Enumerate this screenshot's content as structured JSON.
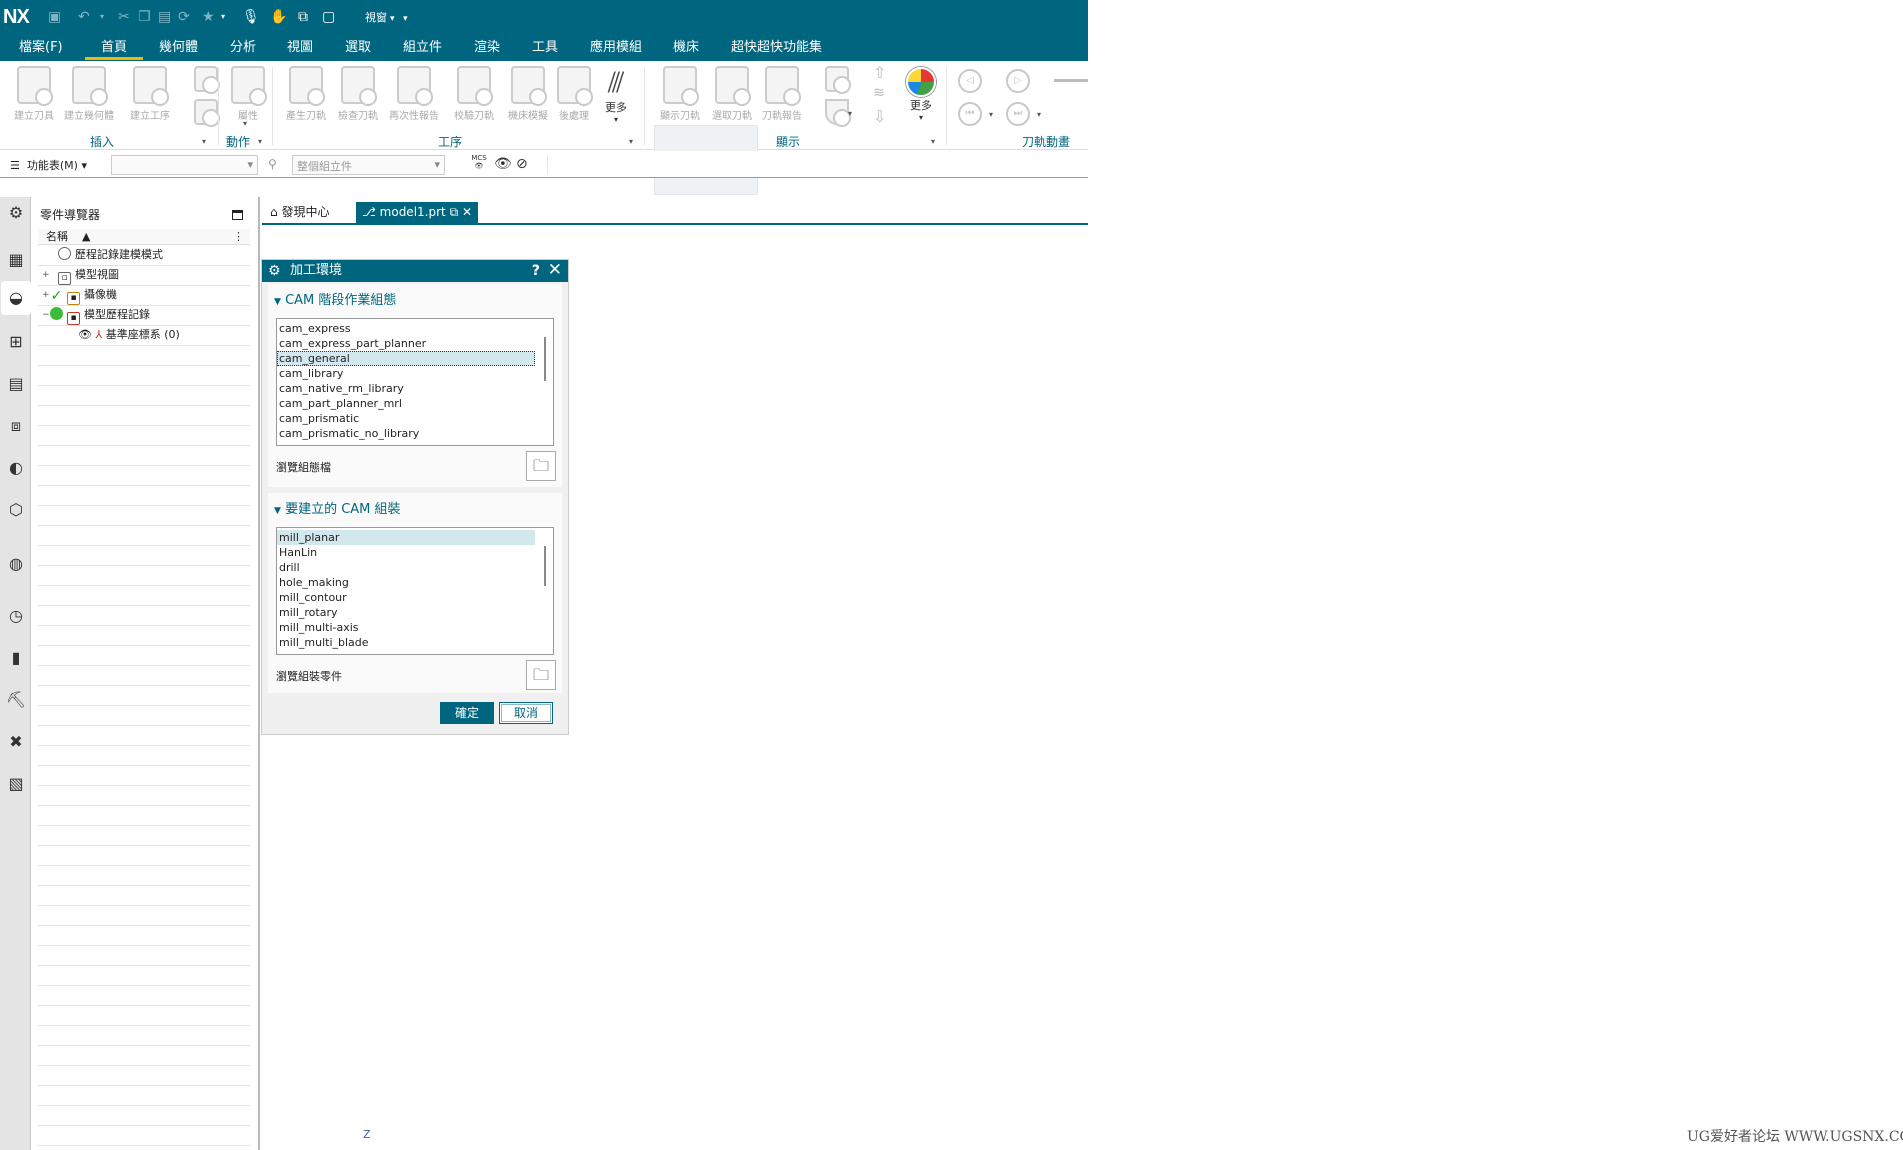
{
  "app": {
    "logo": "NX",
    "view_menu_label": "視窗"
  },
  "menu": [
    "檔案(F)",
    "首頁",
    "幾何體",
    "分析",
    "視圖",
    "選取",
    "組立件",
    "渲染",
    "工具",
    "應用模組",
    "機床",
    "超快超快功能集"
  ],
  "ribbon": {
    "insert_group": {
      "label": "插入",
      "buttons": [
        "建立刀具",
        "建立幾何體",
        "建立工序"
      ]
    },
    "action_group": {
      "label": "動作",
      "buttons": [
        "屬性"
      ]
    },
    "operation_group": {
      "label": "工序",
      "buttons": [
        "產生刀軌",
        "檢查刀軌",
        "再次性報告",
        "校驗刀軌",
        "機床模擬",
        "後處理"
      ],
      "more": "更多"
    },
    "display_group": {
      "label": "顯示",
      "buttons": [
        "顯示刀軌",
        "選取刀軌",
        "刀軌報告"
      ],
      "more": "更多"
    },
    "toolpath_group": {
      "label": "刀軌動畫"
    }
  },
  "toolbar2": {
    "function_menu": "功能表(M)",
    "filter_placeholder": "",
    "scope_placeholder": "整個組立件",
    "mcs_label": "MCS"
  },
  "navigator": {
    "title": "零件導覽器",
    "column": "名稱",
    "items": [
      "歷程記錄建模模式",
      "模型視圖",
      "攝像機",
      "模型歷程記錄",
      "基準座標系 (0)"
    ]
  },
  "tabs": [
    {
      "label": "發現中心"
    },
    {
      "label": "model1.prt"
    }
  ],
  "dialog": {
    "title": "加工環境",
    "section1": {
      "title": "CAM 階段作業組態",
      "items": [
        "cam_express",
        "cam_express_part_planner",
        "cam_general",
        "cam_library",
        "cam_native_rm_library",
        "cam_part_planner_mrl",
        "cam_prismatic",
        "cam_prismatic_no_library"
      ],
      "selected": "cam_general",
      "browse_label": "瀏覽組態檔"
    },
    "section2": {
      "title": "要建立的 CAM 組裝",
      "items": [
        "mill_planar",
        "HanLin",
        "drill",
        "hole_making",
        "mill_contour",
        "mill_rotary",
        "mill_multi-axis",
        "mill_multi_blade"
      ],
      "selected": "mill_planar",
      "browse_label": "瀏覽組裝零件"
    },
    "ok": "確定",
    "cancel": "取消"
  },
  "viewport": {
    "axis_label": "Z"
  },
  "watermark": "UG爱好者论坛 WWW.UGSNX.COM"
}
